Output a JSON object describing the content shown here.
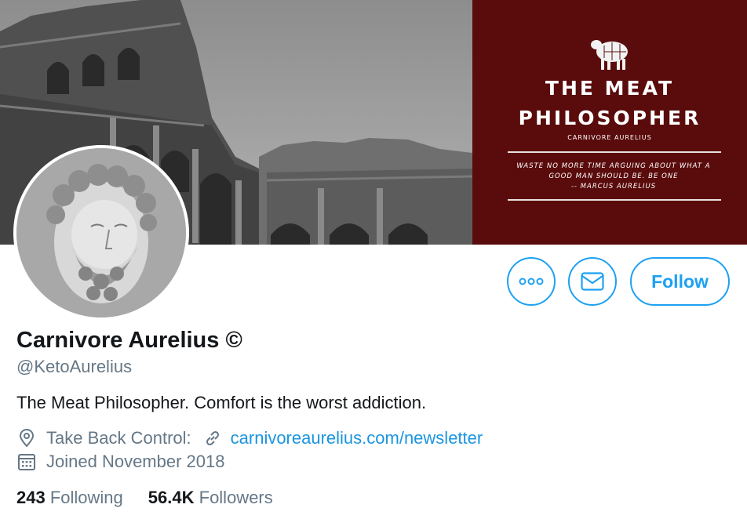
{
  "banner": {
    "title_line1": "THE MEAT",
    "title_line2": "PHILOSOPHER",
    "subtitle": "CARNIVORE AURELIUS",
    "quote_line1": "WASTE NO MORE TIME ARGUING ABOUT WHAT A",
    "quote_line2": "GOOD MAN SHOULD BE. BE ONE",
    "quote_line3": "-- MARCUS AURELIUS",
    "panel_color": "#5a0c0c"
  },
  "profile": {
    "display_name": "Carnivore Aurelius ©",
    "handle": "@KetoAurelius",
    "bio": "The Meat Philosopher. Comfort is the worst addiction.",
    "location": "Take Back Control:",
    "website": "carnivoreaurelius.com/newsletter",
    "joined": "Joined November 2018"
  },
  "actions": {
    "more_icon": "ellipsis-icon",
    "message_icon": "envelope-icon",
    "follow_label": "Follow"
  },
  "stats": {
    "following_count": "243",
    "following_label": "Following",
    "followers_count": "56.4K",
    "followers_label": "Followers"
  },
  "icons": {
    "location": "location-pin-icon",
    "link": "link-icon",
    "calendar": "calendar-icon"
  },
  "colors": {
    "accent": "#1da1f2",
    "link": "#1b95e0",
    "secondary_text": "#657786"
  }
}
